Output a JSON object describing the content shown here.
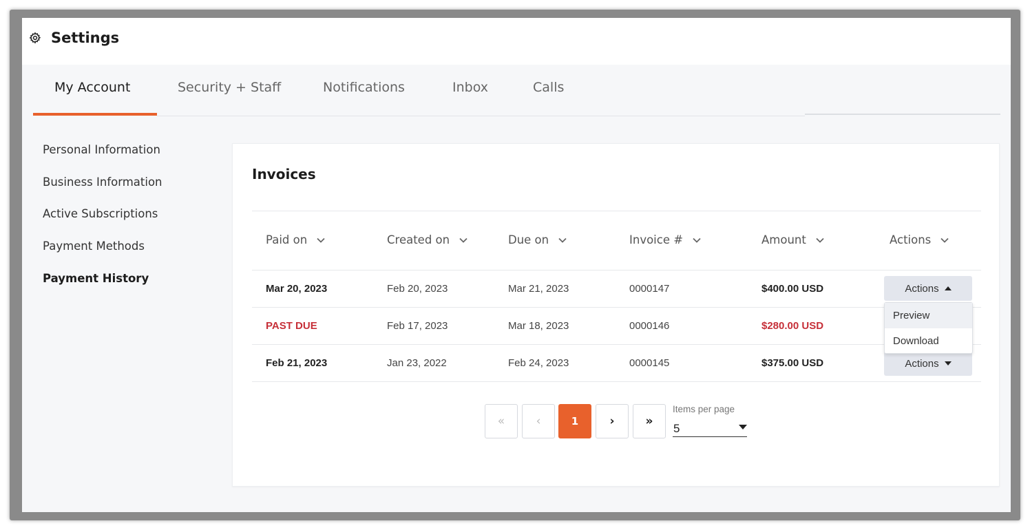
{
  "header": {
    "title": "Settings",
    "icon": "gear-icon"
  },
  "tabs": [
    {
      "label": "My Account",
      "active": true
    },
    {
      "label": "Security + Staff",
      "active": false
    },
    {
      "label": "Notifications",
      "active": false
    },
    {
      "label": "Inbox",
      "active": false
    },
    {
      "label": "Calls",
      "active": false
    }
  ],
  "sidebar": {
    "items": [
      {
        "label": "Personal Information",
        "active": false
      },
      {
        "label": "Business Information",
        "active": false
      },
      {
        "label": "Active Subscriptions",
        "active": false
      },
      {
        "label": "Payment Methods",
        "active": false
      },
      {
        "label": "Payment History",
        "active": true
      }
    ]
  },
  "invoices": {
    "title": "Invoices",
    "columns": [
      "Paid on",
      "Created on",
      "Due on",
      "Invoice #",
      "Amount",
      "Actions"
    ],
    "rows": [
      {
        "paid_on": "Mar 20, 2023",
        "created_on": "Feb 20, 2023",
        "due_on": "Mar 21, 2023",
        "invoice": "0000147",
        "amount": "$400.00 USD",
        "action_label": "Actions",
        "status": "paid"
      },
      {
        "paid_on": "PAST DUE",
        "created_on": "Feb 17, 2023",
        "due_on": "Mar 18, 2023",
        "invoice": "0000146",
        "amount": "$280.00 USD",
        "action_label": "Actions",
        "status": "past_due"
      },
      {
        "paid_on": "Feb 21, 2023",
        "created_on": "Jan 23, 2022",
        "due_on": "Feb 24, 2023",
        "invoice": "0000145",
        "amount": "$375.00 USD",
        "action_label": "Actions",
        "status": "paid"
      }
    ],
    "open_dropdown": {
      "row": 0,
      "items": [
        "Preview",
        "Download"
      ]
    }
  },
  "pagination": {
    "first_label": "«",
    "prev_label": "‹",
    "current_page": "1",
    "next_label": "›",
    "last_label": "»",
    "items_per_page_label": "Items per page",
    "items_per_page_value": "5"
  },
  "colors": {
    "accent": "#e8612c",
    "past_due": "#c62f38",
    "action_button_bg": "#e3e6ed"
  }
}
